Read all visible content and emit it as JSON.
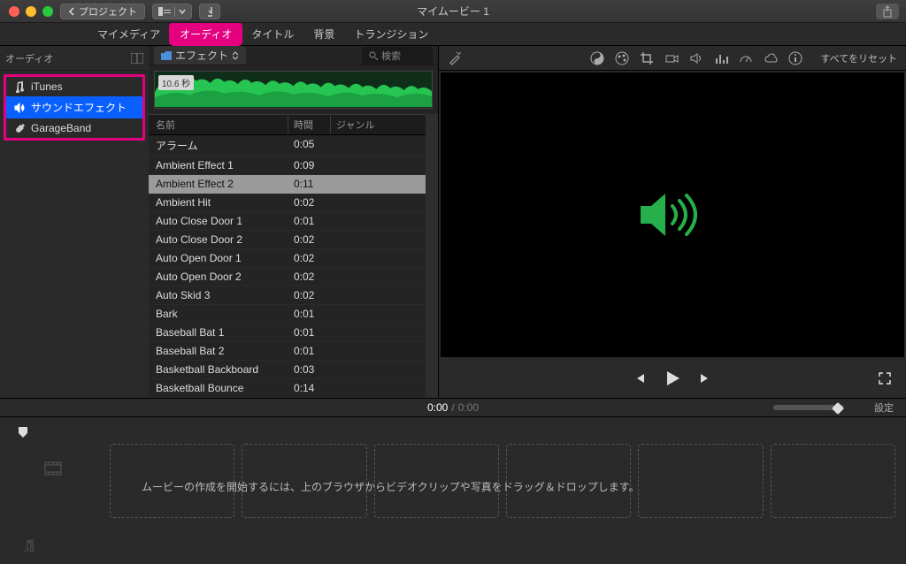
{
  "titlebar": {
    "back_label": "プロジェクト",
    "title": "マイムービー 1"
  },
  "tabs": {
    "mymedia": "マイメディア",
    "audio": "オーディオ",
    "titles": "タイトル",
    "backgrounds": "背景",
    "transitions": "トランジション"
  },
  "sidebar": {
    "header": "オーディオ",
    "items": [
      {
        "label": "iTunes"
      },
      {
        "label": "サウンドエフェクト"
      },
      {
        "label": "GarageBand"
      }
    ]
  },
  "browser": {
    "crumb": "エフェクト",
    "search_placeholder": "検索",
    "duration_badge": "10.6 秒",
    "columns": {
      "name": "名前",
      "time": "時間",
      "genre": "ジャンル"
    },
    "rows": [
      {
        "name": "アラーム",
        "time": "0:05",
        "genre": ""
      },
      {
        "name": "Ambient Effect 1",
        "time": "0:09",
        "genre": ""
      },
      {
        "name": "Ambient Effect 2",
        "time": "0:11",
        "genre": "",
        "selected": true
      },
      {
        "name": "Ambient Hit",
        "time": "0:02",
        "genre": ""
      },
      {
        "name": "Auto Close Door 1",
        "time": "0:01",
        "genre": ""
      },
      {
        "name": "Auto Close Door 2",
        "time": "0:02",
        "genre": ""
      },
      {
        "name": "Auto Open Door 1",
        "time": "0:02",
        "genre": ""
      },
      {
        "name": "Auto Open Door 2",
        "time": "0:02",
        "genre": ""
      },
      {
        "name": "Auto Skid 3",
        "time": "0:02",
        "genre": ""
      },
      {
        "name": "Bark",
        "time": "0:01",
        "genre": ""
      },
      {
        "name": "Baseball Bat 1",
        "time": "0:01",
        "genre": ""
      },
      {
        "name": "Baseball Bat 2",
        "time": "0:01",
        "genre": ""
      },
      {
        "name": "Basketball Backboard",
        "time": "0:03",
        "genre": ""
      },
      {
        "name": "Basketball Bounce",
        "time": "0:14",
        "genre": ""
      }
    ]
  },
  "toolbar": {
    "reset": "すべてをリセット"
  },
  "time": {
    "elapsed": "0:00",
    "total": "0:00",
    "settings": "設定"
  },
  "timeline": {
    "hint": "ムービーの作成を開始するには、上のブラウザからビデオクリップや写真をドラッグ＆ドロップします。"
  }
}
